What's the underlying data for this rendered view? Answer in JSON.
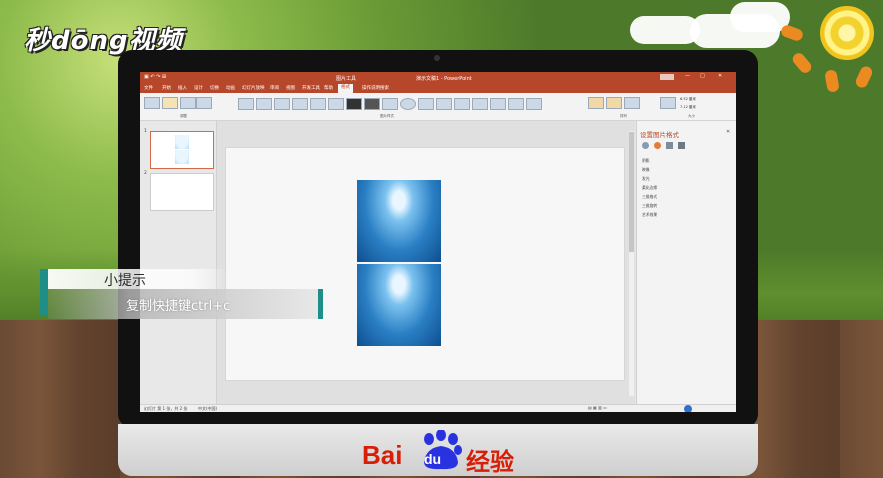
{
  "watermark": {
    "logo_text": "秒dōng视频"
  },
  "powerpoint": {
    "title_text": "演示文稿1 - PowerPoint",
    "context_tab": "图片工具",
    "tabs": [
      "文件",
      "开始",
      "插入",
      "设计",
      "切换",
      "动画",
      "幻灯片放映",
      "审阅",
      "视图",
      "开发工具",
      "帮助",
      "格式"
    ],
    "active_tab": "格式",
    "tell_me": "操作说明搜索",
    "ribbon_groups": [
      "调整",
      "图片样式",
      "排列",
      "大小"
    ],
    "size_height": "6.52 厘米",
    "size_width": "7.12 厘米",
    "slide_numbers": [
      "1",
      "2"
    ],
    "status_left": "幻灯片 第 1 张，共 2 张",
    "status_lang": "中文(中国)",
    "format_pane": {
      "title": "设置图片格式",
      "items": [
        "阴影",
        "映像",
        "发光",
        "柔化边缘",
        "三维格式",
        "三维旋转",
        "艺术效果"
      ]
    }
  },
  "tip": {
    "title": "小提示",
    "body": "复制快捷键ctrl+c",
    "accent_color": "#1f8e88"
  },
  "footer_logo": {
    "bai": "Bai",
    "du": "du",
    "jingyan": "经验",
    "brand_color": "#d81e06"
  }
}
